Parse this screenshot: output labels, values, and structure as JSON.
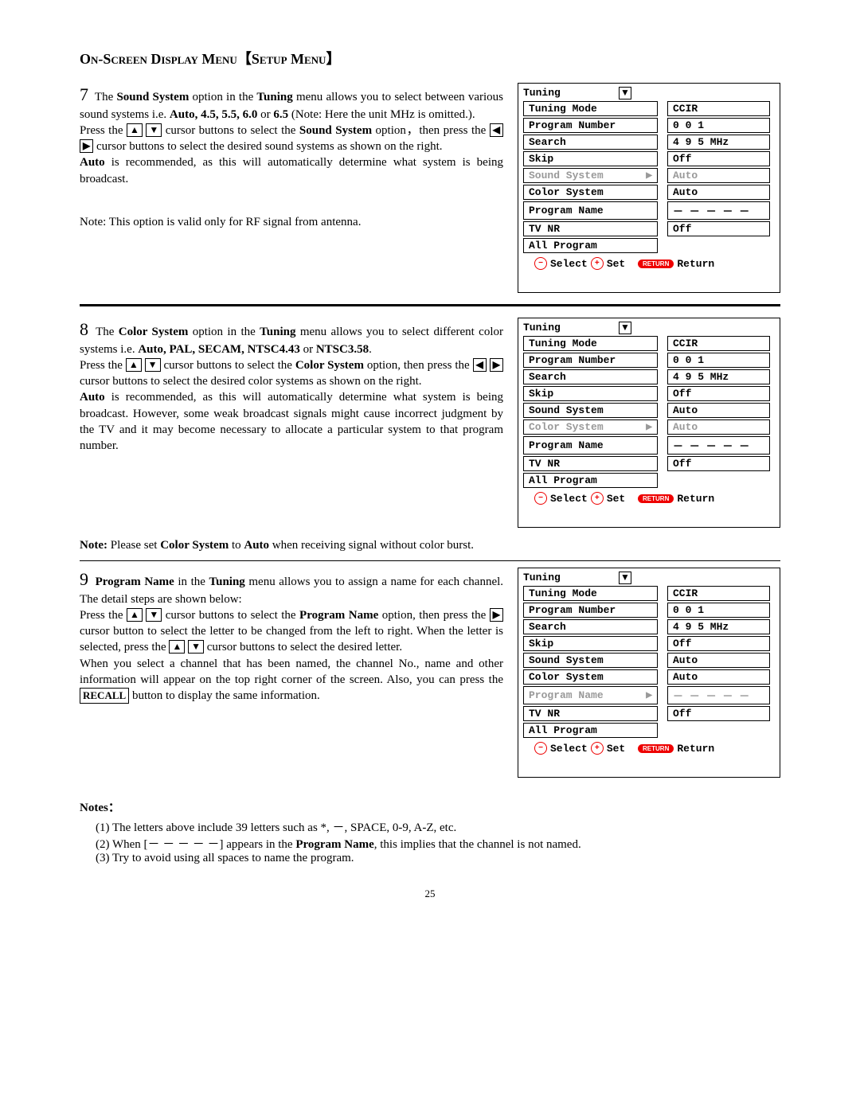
{
  "page_title_a": "On-Screen Display Menu",
  "page_title_b": "Setup Menu",
  "sec7": {
    "num": "7",
    "intro_a": "The ",
    "intro_b": "Sound System",
    "intro_c": " option in the ",
    "intro_d": "Tuning",
    "intro_e": " menu allows you to select between various sound systems i.e. ",
    "opts": "Auto, 4.5, 5.5, 6.0",
    "opts_or": " or ",
    "opts_last": "6.5",
    "note_paren": " (Note: Here the unit MHz is omitted.).",
    "press": "Press the ",
    "line2a": " cursor buttons to select the ",
    "line2b": "Sound System",
    "line2c": " option，then press the ",
    "line2d": " cursor buttons to select the desired sound systems as shown on the right.",
    "auto_a": "Auto",
    "auto_b": " is recommended, as this will automatically determine what system is being broadcast.",
    "note_line": "Note: This option is valid only for RF signal from antenna."
  },
  "sec8": {
    "num": "8",
    "intro_a": "The ",
    "intro_b": "Color System",
    "intro_c": " option in the ",
    "intro_d": "Tuning",
    "intro_e": " menu allows you to select different color systems i.e. ",
    "opts": "Auto, PAL, SECAM, NTSC4.43",
    "opts_or": " or ",
    "opts_last": "NTSC3.58",
    "press": "Press the ",
    "line2a": " cursor buttons to select the ",
    "line2b": "Color System",
    "line2c": " option, then press the ",
    "line2d": " cursor buttons to select the desired color systems as shown on the right.",
    "auto_a": "Auto",
    "auto_b": " is recommended, as this will automatically determine what system is being broadcast. However, some weak broadcast signals might cause incorrect judgment by the TV and it may become necessary to allocate a particular system to that program number.",
    "note_a": "Note:",
    "note_b": " Please set ",
    "note_c": "Color System",
    "note_d": " to ",
    "note_e": "Auto",
    "note_f": " when receiving signal without color burst."
  },
  "sec9": {
    "num": "9",
    "intro_a": "Program Name",
    "intro_b": " in the ",
    "intro_c": "Tuning",
    "intro_d": " menu allows you to assign a name for each channel. The detail steps are shown below:",
    "press": "Press the ",
    "l2a": " cursor buttons to select the ",
    "l2b": "Program Name",
    "l2c": " option, then press the ",
    "l2d": " cursor button to select the letter to be changed from the left to right. When the letter is selected, press the ",
    "l2e": " cursor buttons to select the desired letter.",
    "l3a": "When you select a channel that has been named, the channel No., name and other information will appear on the top right corner of the screen. Also, you can press the ",
    "l3b": "RECALL",
    "l3c": " button to display the same information."
  },
  "osd_title": "Tuning",
  "osd_rows": {
    "tuning_mode": "Tuning Mode",
    "program_number": "Program Number",
    "search": "Search",
    "skip": "Skip",
    "sound_system": "Sound System",
    "color_system": "Color System",
    "program_name": "Program Name",
    "tv_nr": "TV NR",
    "all_program": "All Program"
  },
  "osd_vals": {
    "ccir": "CCIR",
    "pn": "0 0 1",
    "search": "4 9 5 MHz",
    "off": "Off",
    "auto": "Auto",
    "pname": "－ － － － －"
  },
  "footer": {
    "select": "Select",
    "set": "Set",
    "return_btn": "RETURN",
    "return": "Return"
  },
  "notes_heading": "Notes：",
  "notes": {
    "n1": "(1) The letters above include 39 letters such as *, －, SPACE, 0-9, A-Z, etc.",
    "n2a": "(2) When [－ － － － －] appears in the ",
    "n2b": "Program Name",
    "n2c": ", this implies that the channel is not named.",
    "n3": "(3) Try to avoid using all spaces to name the program."
  },
  "page_number": "25"
}
